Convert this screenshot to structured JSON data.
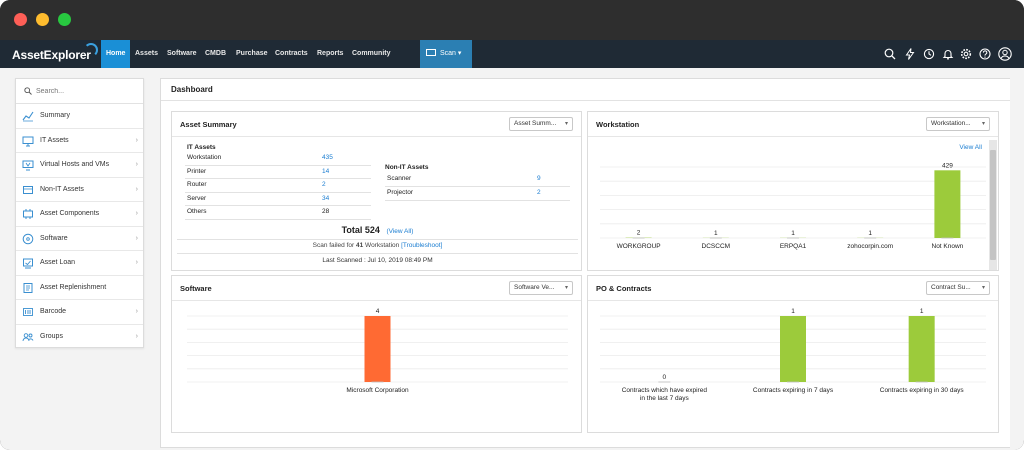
{
  "app": {
    "logo": "AssetExplorer"
  },
  "nav": {
    "items": [
      {
        "label": "Home"
      },
      {
        "label": "Assets"
      },
      {
        "label": "Software"
      },
      {
        "label": "CMDB"
      },
      {
        "label": "Purchase"
      },
      {
        "label": "Contracts"
      },
      {
        "label": "Reports"
      },
      {
        "label": "Community"
      }
    ],
    "scan_label": "Scan",
    "icons": [
      "search-icon",
      "lightning-icon",
      "history-icon",
      "bell-icon",
      "gear-icon",
      "help-icon",
      "user-icon"
    ]
  },
  "sidebar": {
    "search_placeholder": "Search...",
    "items": [
      {
        "label": "Summary",
        "icon": "chart-line-icon",
        "has_submenu": false
      },
      {
        "label": "IT Assets",
        "icon": "monitor-icon",
        "has_submenu": true
      },
      {
        "label": "Virtual Hosts and VMs",
        "icon": "virtual-monitor-icon",
        "has_submenu": true
      },
      {
        "label": "Non-IT Assets",
        "icon": "box-icon",
        "has_submenu": true
      },
      {
        "label": "Asset Components",
        "icon": "component-icon",
        "has_submenu": true
      },
      {
        "label": "Software",
        "icon": "disc-icon",
        "has_submenu": true
      },
      {
        "label": "Asset Loan",
        "icon": "loan-icon",
        "has_submenu": true
      },
      {
        "label": "Asset Replenishment",
        "icon": "replenish-icon",
        "has_submenu": false
      },
      {
        "label": "Barcode",
        "icon": "barcode-icon",
        "has_submenu": true
      },
      {
        "label": "Groups",
        "icon": "groups-icon",
        "has_submenu": true
      }
    ]
  },
  "dashboard": {
    "title": "Dashboard",
    "asset_summary": {
      "title": "Asset Summary",
      "select": "Asset Summ...",
      "it_header": "IT Assets",
      "it_rows": [
        {
          "label": "Workstation",
          "value": "435",
          "link": true
        },
        {
          "label": "Printer",
          "value": "14",
          "link": true
        },
        {
          "label": "Router",
          "value": "2",
          "link": true
        },
        {
          "label": "Server",
          "value": "34",
          "link": true
        },
        {
          "label": "Others",
          "value": "28",
          "link": false
        }
      ],
      "nonit_header": "Non-IT Assets",
      "nonit_rows": [
        {
          "label": "Scanner",
          "value": "9"
        },
        {
          "label": "Projector",
          "value": "2"
        }
      ],
      "total_label": "Total 524",
      "view_all": "(View All)",
      "scan_failed_prefix": "Scan failed for",
      "scan_failed_count": "41",
      "scan_failed_suffix": "Workstation",
      "troubleshoot": "[Troubleshoot]",
      "last_scanned": "Last Scanned : Jul 10, 2019 08:49 PM"
    },
    "workstation": {
      "title": "Workstation",
      "select": "Workstation...",
      "view_all": "View All"
    },
    "software": {
      "title": "Software",
      "select": "Software Ve..."
    },
    "po_contracts": {
      "title": "PO & Contracts",
      "select": "Contract Su..."
    }
  },
  "chart_data": [
    {
      "type": "bar",
      "categories": [
        "WORKGROUP",
        "DCSCCM",
        "ERPQA1",
        "zohocorpin.com",
        "Not Known"
      ],
      "values": [
        2,
        1,
        1,
        1,
        429
      ],
      "colors": [
        "#9ccb3b"
      ],
      "ylim": [
        0,
        450
      ]
    },
    {
      "type": "bar",
      "categories": [
        "Microsoft Corporation"
      ],
      "values": [
        4
      ],
      "colors": [
        "#ff6a33"
      ],
      "ylim": [
        0,
        4
      ]
    },
    {
      "type": "bar",
      "categories": [
        "Contracts which have expired in the last 7 days",
        "Contracts expiring in 7 days",
        "Contracts expiring in 30 days"
      ],
      "values": [
        0,
        1,
        1
      ],
      "colors": [
        "#9ccb3b"
      ],
      "ylim": [
        0,
        1
      ]
    }
  ]
}
